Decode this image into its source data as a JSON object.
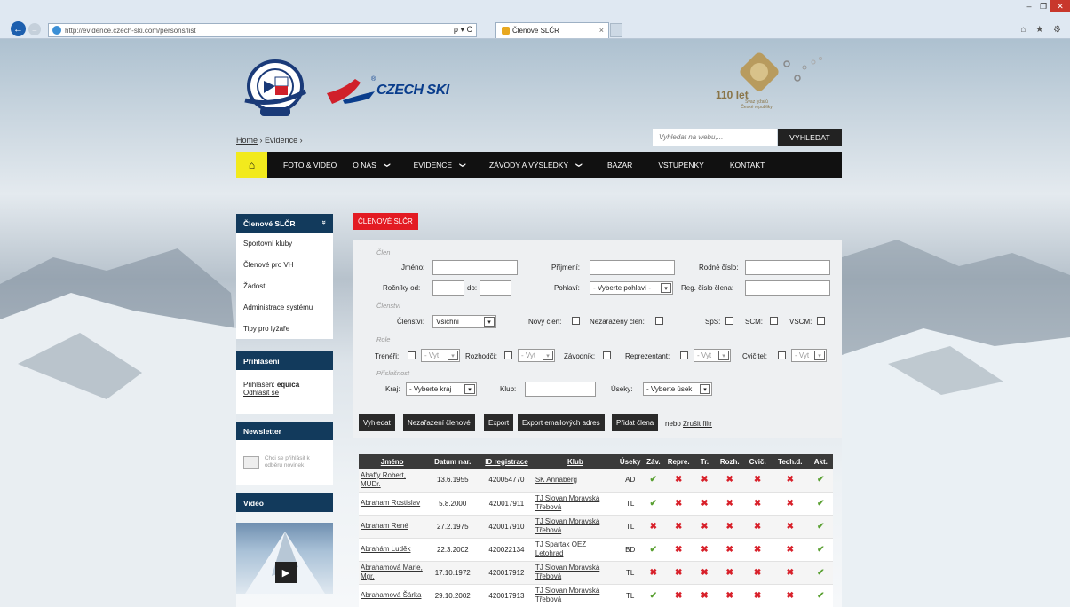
{
  "browser": {
    "url": "http://evidence.czech-ski.com/persons/list",
    "tab_title": "Členové SLČR",
    "addr_tools": "ρ ▾ C"
  },
  "logo": {
    "brand": "CZECH SKI",
    "reg_mark": "®",
    "anniversary": "110 let",
    "anniversary_sub": "Svaz lyžařů České republiky"
  },
  "breadcrumb": {
    "home": "Home",
    "sep": "›",
    "evidence": "Evidence"
  },
  "search": {
    "placeholder": "Vyhledat na webu,...",
    "button": "VYHLEDAT"
  },
  "nav": {
    "items": [
      {
        "label": "FOTO & VIDEO",
        "chev": ""
      },
      {
        "label": "O NÁS",
        "chev": "❯"
      },
      {
        "label": "EVIDENCE",
        "chev": "❯"
      },
      {
        "label": "ZÁVODY A VÝSLEDKY",
        "chev": "❯"
      },
      {
        "label": "BAZAR",
        "chev": ""
      },
      {
        "label": "VSTUPENKY",
        "chev": ""
      },
      {
        "label": "KONTAKT",
        "chev": ""
      }
    ]
  },
  "sidebar": {
    "head1": "Členové SLČR",
    "head1_chev": "»",
    "items": [
      "Sportovní kluby",
      "Členové pro VH",
      "Žádosti",
      "Administrace systému",
      "Tipy pro lyžaře"
    ],
    "login_head": "Přihlášení",
    "logged_prefix": "Přihlášen:",
    "user": "equica",
    "logout": "Odhlásit se",
    "newsletter_head": "Newsletter",
    "newsletter_text": "Chci se přihlásit k odběru novinek",
    "video_head": "Video"
  },
  "page_tag": "ČLENOVÉ SLČR",
  "filter": {
    "sec_clen": "Člen",
    "jmeno": "Jméno:",
    "prijmeni": "Příjmení:",
    "rodne": "Rodné číslo:",
    "rocniky": "Ročníky od:",
    "do": "do:",
    "pohlavi": "Pohlaví:",
    "pohlavi_val": "- Vyberte pohlaví -",
    "reg": "Reg. číslo člena:",
    "sec_clenstvi": "Členství",
    "clenstvi": "Členství:",
    "clenstvi_val": "Všichni",
    "novy": "Nový člen:",
    "nezarazeny": "Nezařazený člen:",
    "sps": "SpS:",
    "scm": "SCM:",
    "vscm": "VSCM:",
    "sec_role": "Role",
    "treneri": "Trenéři:",
    "rozhodci": "Rozhodčí:",
    "zavodnik": "Závodník:",
    "reprezentant": "Reprezentant:",
    "cvicitel": "Cvičitel:",
    "vyt": "- Vyt",
    "sec_prislusnost": "Příslušnost",
    "kraj": "Kraj:",
    "kraj_val": "- Vyberte kraj",
    "klub": "Klub:",
    "useky": "Úseky:",
    "useky_val": "- Vyberte úsek"
  },
  "actions": {
    "vyhledat": "Vyhledat",
    "nezarazeni": "Nezařazení členové",
    "export": "Export",
    "export_email": "Export emailových adres",
    "pridat": "Přidat člena",
    "nebo": "nebo",
    "zrusit": "Zrušit filtr"
  },
  "table": {
    "headers": [
      "Jméno",
      "Datum nar.",
      "ID registrace",
      "Klub",
      "Úseky",
      "Záv.",
      "Repre.",
      "Tr.",
      "Rozh.",
      "Cvič.",
      "Tech.d.",
      "Akt."
    ],
    "rows": [
      {
        "name": "Abaffy Robert, MUDr.",
        "date": "13.6.1955",
        "id": "420054770",
        "club": "SK Annaberg",
        "useky": "AD",
        "flags": [
          1,
          0,
          0,
          0,
          0,
          0,
          1
        ]
      },
      {
        "name": "Abraham Rostislav",
        "date": "5.8.2000",
        "id": "420017911",
        "club": "TJ Slovan Moravská Třebová",
        "useky": "TL",
        "flags": [
          1,
          0,
          0,
          0,
          0,
          0,
          1
        ]
      },
      {
        "name": "Abraham René",
        "date": "27.2.1975",
        "id": "420017910",
        "club": "TJ Slovan Moravská Třebová",
        "useky": "TL",
        "flags": [
          0,
          0,
          0,
          0,
          0,
          0,
          1
        ]
      },
      {
        "name": "Abrahám Luděk",
        "date": "22.3.2002",
        "id": "420022134",
        "club": "TJ Spartak OEZ Letohrad",
        "useky": "BD",
        "flags": [
          1,
          0,
          0,
          0,
          0,
          0,
          1
        ]
      },
      {
        "name": "Abrahamová Marie, Mgr.",
        "date": "17.10.1972",
        "id": "420017912",
        "club": "TJ Slovan Moravská Třebová",
        "useky": "TL",
        "flags": [
          0,
          0,
          0,
          0,
          0,
          0,
          1
        ]
      },
      {
        "name": "Abrahamová Šárka",
        "date": "29.10.2002",
        "id": "420017913",
        "club": "TJ Slovan Moravská Třebová",
        "useky": "TL",
        "flags": [
          1,
          0,
          0,
          0,
          0,
          0,
          1
        ]
      }
    ]
  },
  "colors": {
    "nav_bg": "#111111",
    "home_yellow": "#f2ea1d",
    "accent_red": "#e31b23",
    "sidebar_head": "#123a5c",
    "check": "#5aa032",
    "cross": "#d8202a"
  }
}
